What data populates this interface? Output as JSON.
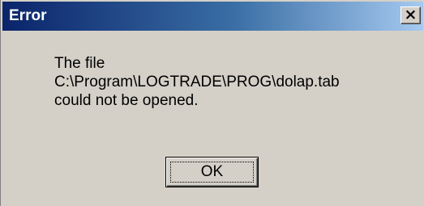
{
  "window": {
    "title": "Error",
    "close_label": "×"
  },
  "message": {
    "lines": [
      "The file",
      "C:\\Program\\LOGTRADE\\PROG\\dolap.tab",
      "could not be opened."
    ]
  },
  "buttons": {
    "ok_label": "OK"
  },
  "icons": {
    "close": "close-icon"
  },
  "colors": {
    "title_bar_start": "#0a246a",
    "title_bar_end": "#a6caf0",
    "dialog_face": "#d4d0c8"
  }
}
